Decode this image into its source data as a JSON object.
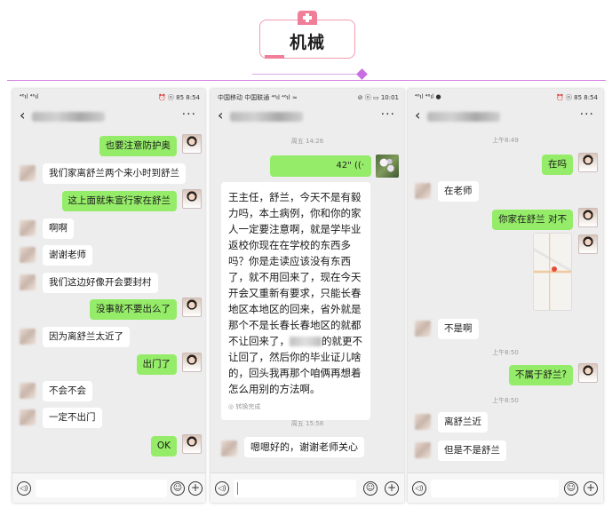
{
  "header": {
    "title": "机械"
  },
  "phones": [
    {
      "status_left": "⁴⁶ıl ⁴⁶ıl",
      "status_right": "⏰ ⓝ 85 8:54",
      "back": "‹",
      "more": "···",
      "messages": [
        {
          "side": "out",
          "text": "也要注意防护奥"
        },
        {
          "side": "in",
          "text": "我们家离舒兰两个来小时到舒兰"
        },
        {
          "side": "out",
          "text": "这上面就朱宣行家在舒兰"
        },
        {
          "side": "in",
          "text": "啊啊"
        },
        {
          "side": "in",
          "text": "谢谢老师"
        },
        {
          "side": "in",
          "text": "我们这边好像开会要封村"
        },
        {
          "side": "out",
          "text": "没事就不要出么了"
        },
        {
          "side": "in",
          "text": "因为离舒兰太近了"
        },
        {
          "side": "out",
          "text": "出门了"
        },
        {
          "side": "in",
          "text": "不会不会"
        },
        {
          "side": "in",
          "text": "一定不出门"
        },
        {
          "side": "out",
          "text": "OK"
        }
      ]
    },
    {
      "status_left": "中国移动 中国联通 ⁴⁶ıl ⁴⁶ıl ≈",
      "status_right": "⊘ ⓝ ▭ 10:01",
      "back": "‹",
      "more": "···",
      "time1": "周五 14:26",
      "voice": "42\" ((·",
      "long_text_a": "王主任，舒兰，今天不是有毅力吗，本土病例，你和你的家人一定要注意啊，就是学毕业返校你现在在学校的东西多吗？你是走读应该没有东西了，就不用回来了，现在今天开会又重新有要求，只能长春地区本地区的回来，省外就是那个不是长春长春地区的就都不让回来了，",
      "long_text_b": "的就更不让回了，然后你的毕业证儿啥的，回头我再那个咱俩再想着怎么用别的方法啊。",
      "convert_note": "◎ 转换完成",
      "time2": "周五 15:58",
      "partial_msg": "嗯嗯好的，谢谢老师关心"
    },
    {
      "status_left": "⁴⁶ıl ⁴⁶ıl ●",
      "status_right": "⏰ ⓝ 85 8:54",
      "back": "‹",
      "more": "···",
      "time1": "上午8:49",
      "msg1": "在吗",
      "msg2": "在老师",
      "msg3": "你家在舒兰 对不",
      "msg4": "不是啊",
      "time2": "上午8:50",
      "msg5": "不属于舒兰?",
      "time3": "上午8:50",
      "msg6": "离舒兰近",
      "msg7": "但是不是舒兰"
    }
  ],
  "input": {
    "voice_icon": "◁)",
    "emoji_icon": "☺",
    "plus_icon": "+"
  }
}
